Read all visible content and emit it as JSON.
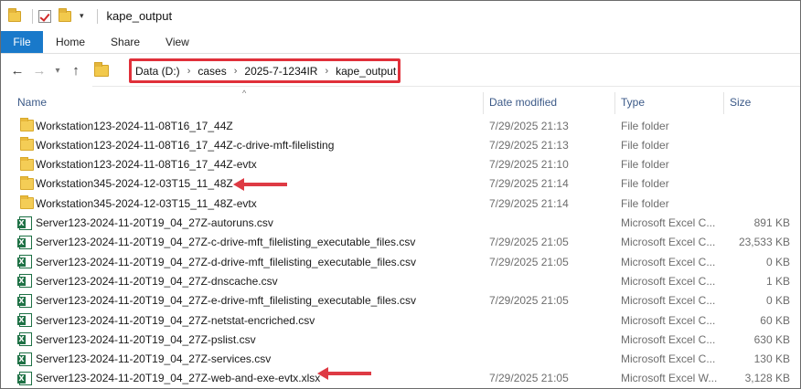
{
  "window": {
    "title": "kape_output"
  },
  "ribbon": {
    "tabs": [
      "File",
      "Home",
      "Share",
      "View"
    ]
  },
  "address": {
    "breadcrumbs": [
      "Data (D:)",
      "cases",
      "2025-7-1234IR",
      "kape_output"
    ]
  },
  "columns": {
    "name": "Name",
    "date": "Date modified",
    "type": "Type",
    "size": "Size"
  },
  "colors": {
    "accent": "#1979ca",
    "highlight": "#e0303a",
    "header_text": "#3c5a88"
  },
  "files": [
    {
      "name": "Workstation123-2024-11-08T16_17_44Z",
      "date": "7/29/2025 21:13",
      "type": "File folder",
      "size": "",
      "icon": "folder-icon"
    },
    {
      "name": "Workstation123-2024-11-08T16_17_44Z-c-drive-mft-filelisting",
      "date": "7/29/2025 21:13",
      "type": "File folder",
      "size": "",
      "icon": "folder-icon"
    },
    {
      "name": "Workstation123-2024-11-08T16_17_44Z-evtx",
      "date": "7/29/2025 21:10",
      "type": "File folder",
      "size": "",
      "icon": "folder-icon"
    },
    {
      "name": "Workstation345-2024-12-03T15_11_48Z",
      "date": "7/29/2025 21:14",
      "type": "File folder",
      "size": "",
      "icon": "folder-icon"
    },
    {
      "name": "Workstation345-2024-12-03T15_11_48Z-evtx",
      "date": "7/29/2025 21:14",
      "type": "File folder",
      "size": "",
      "icon": "folder-icon"
    },
    {
      "name": "Server123-2024-11-20T19_04_27Z-autoruns.csv",
      "date": "",
      "type": "Microsoft Excel C...",
      "size": "891 KB",
      "icon": "excel-icon"
    },
    {
      "name": "Server123-2024-11-20T19_04_27Z-c-drive-mft_filelisting_executable_files.csv",
      "date": "7/29/2025 21:05",
      "type": "Microsoft Excel C...",
      "size": "23,533 KB",
      "icon": "excel-icon"
    },
    {
      "name": "Server123-2024-11-20T19_04_27Z-d-drive-mft_filelisting_executable_files.csv",
      "date": "7/29/2025 21:05",
      "type": "Microsoft Excel C...",
      "size": "0 KB",
      "icon": "excel-icon"
    },
    {
      "name": "Server123-2024-11-20T19_04_27Z-dnscache.csv",
      "date": "",
      "type": "Microsoft Excel C...",
      "size": "1 KB",
      "icon": "excel-icon"
    },
    {
      "name": "Server123-2024-11-20T19_04_27Z-e-drive-mft_filelisting_executable_files.csv",
      "date": "7/29/2025 21:05",
      "type": "Microsoft Excel C...",
      "size": "0 KB",
      "icon": "excel-icon"
    },
    {
      "name": "Server123-2024-11-20T19_04_27Z-netstat-encriched.csv",
      "date": "",
      "type": "Microsoft Excel C...",
      "size": "60 KB",
      "icon": "excel-icon"
    },
    {
      "name": "Server123-2024-11-20T19_04_27Z-pslist.csv",
      "date": "",
      "type": "Microsoft Excel C...",
      "size": "630 KB",
      "icon": "excel-icon"
    },
    {
      "name": "Server123-2024-11-20T19_04_27Z-services.csv",
      "date": "",
      "type": "Microsoft Excel C...",
      "size": "130 KB",
      "icon": "excel-icon"
    },
    {
      "name": "Server123-2024-11-20T19_04_27Z-web-and-exe-evtx.xlsx",
      "date": "7/29/2025 21:05",
      "type": "Microsoft Excel W...",
      "size": "3,128 KB",
      "icon": "excel-icon"
    }
  ]
}
